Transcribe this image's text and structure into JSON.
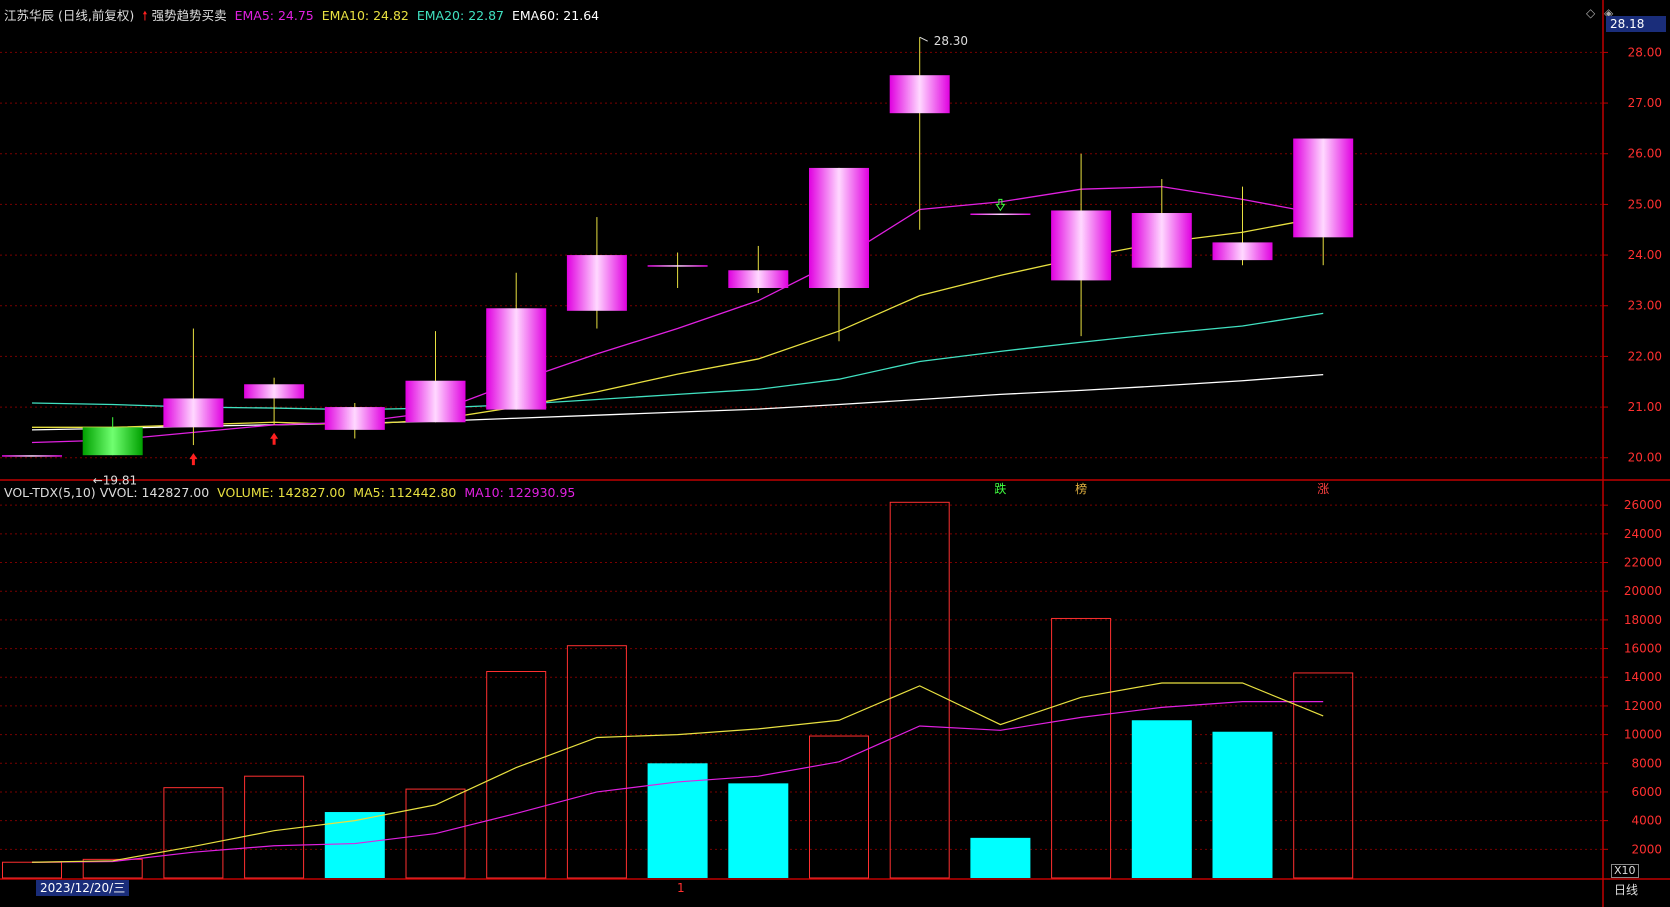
{
  "header": {
    "stock_title": "江苏华辰 (日线,前复权)",
    "indicator_name": "强势趋势买卖",
    "ema5": "EMA5: 24.75",
    "ema10": "EMA10: 24.82",
    "ema20": "EMA20: 22.87",
    "ema60": "EMA60: 21.64",
    "current_price": "28.18"
  },
  "volume_header": {
    "name": "VOL-TDX(5,10)",
    "vvol": "VVOL: 142827.00",
    "volume": "VOLUME: 142827.00",
    "ma5": "MA5: 112442.80",
    "ma10": "MA10: 122930.95"
  },
  "footer": {
    "date": "2023/12/20/三",
    "period": "日线",
    "unit": "X10",
    "marker": "1"
  },
  "colors": {
    "up": "#ff33ff",
    "down": "#00d000",
    "ema5": "#e020e0",
    "ema10": "#e8e040",
    "ema20": "#40e0c0",
    "ema60": "#ffffff",
    "vol_up": "#ff3030",
    "vol_down": "#00ffff",
    "grid": "#7a0000",
    "axis_text": "#ff3030"
  },
  "chart_data": [
    {
      "type": "candlestick",
      "ylim": [
        19.6,
        28.6
      ],
      "yticks": [
        "28.00",
        "27.00",
        "26.00",
        "25.00",
        "24.00",
        "23.00",
        "22.00",
        "21.00",
        "20.00"
      ],
      "high_label": "28.30",
      "low_label": "←19.81",
      "candles": [
        {
          "o": 20.05,
          "c": 20.05,
          "h": 20.05,
          "l": 20.05
        },
        {
          "o": 20.6,
          "c": 20.05,
          "h": 20.8,
          "l": 20.05
        },
        {
          "o": 20.6,
          "c": 21.17,
          "h": 22.55,
          "l": 20.25
        },
        {
          "o": 21.17,
          "c": 21.45,
          "h": 21.58,
          "l": 20.65
        },
        {
          "o": 20.55,
          "c": 21.0,
          "h": 21.08,
          "l": 20.38
        },
        {
          "o": 20.7,
          "c": 21.52,
          "h": 22.5,
          "l": 20.7
        },
        {
          "o": 20.95,
          "c": 22.95,
          "h": 23.65,
          "l": 20.95
        },
        {
          "o": 22.9,
          "c": 24.0,
          "h": 24.75,
          "l": 22.55
        },
        {
          "o": 23.8,
          "c": 23.8,
          "h": 24.05,
          "l": 23.35
        },
        {
          "o": 23.35,
          "c": 23.7,
          "h": 24.18,
          "l": 23.25
        },
        {
          "o": 23.35,
          "c": 25.72,
          "h": 25.72,
          "l": 22.3
        },
        {
          "o": 26.8,
          "c": 27.55,
          "h": 28.3,
          "l": 24.5
        },
        {
          "o": 24.82,
          "c": 24.82,
          "h": 24.82,
          "l": 24.82
        },
        {
          "o": 23.5,
          "c": 24.88,
          "h": 26.0,
          "l": 22.4
        },
        {
          "o": 23.75,
          "c": 24.83,
          "h": 25.5,
          "l": 23.75
        },
        {
          "o": 23.9,
          "c": 24.25,
          "h": 25.35,
          "l": 23.8
        },
        {
          "o": 24.35,
          "c": 26.3,
          "h": 26.3,
          "l": 23.8
        }
      ],
      "ema5": [
        20.3,
        20.35,
        20.5,
        20.65,
        20.7,
        20.9,
        21.5,
        22.05,
        22.55,
        23.1,
        23.9,
        24.9,
        25.05,
        25.3,
        25.35,
        25.1,
        24.8
      ],
      "ema10": [
        20.6,
        20.6,
        20.65,
        20.7,
        20.65,
        20.75,
        21.0,
        21.3,
        21.65,
        21.95,
        22.5,
        23.2,
        23.6,
        23.95,
        24.25,
        24.45,
        24.75
      ],
      "ema20": [
        21.08,
        21.05,
        21.0,
        20.98,
        20.95,
        20.98,
        21.05,
        21.15,
        21.25,
        21.35,
        21.55,
        21.9,
        22.1,
        22.28,
        22.45,
        22.6,
        22.85
      ],
      "ema60": [
        20.55,
        20.58,
        20.62,
        20.65,
        20.68,
        20.72,
        20.78,
        20.84,
        20.9,
        20.96,
        21.05,
        21.15,
        21.25,
        21.33,
        21.42,
        21.52,
        21.64
      ],
      "buy_arrows": [
        2,
        3
      ],
      "signal_labels": [
        {
          "index": 12,
          "text": "跌"
        },
        {
          "index": 13,
          "text": "榜"
        },
        {
          "index": 16,
          "text": "涨"
        }
      ]
    },
    {
      "type": "bar",
      "ylim": [
        0,
        26500
      ],
      "yticks": [
        "26000",
        "24000",
        "22000",
        "20000",
        "18000",
        "16000",
        "14000",
        "12000",
        "10000",
        "8000",
        "6000",
        "4000",
        "2000"
      ],
      "values": [
        1100,
        1300,
        6300,
        7100,
        4600,
        6200,
        14400,
        16200,
        8000,
        6600,
        9900,
        26200,
        2800,
        18100,
        11000,
        10200,
        14300
      ],
      "up": [
        true,
        true,
        true,
        true,
        false,
        true,
        true,
        true,
        false,
        false,
        true,
        true,
        false,
        true,
        false,
        false,
        true
      ],
      "ma5": [
        1100,
        1200,
        2200,
        3300,
        4000,
        5100,
        7700,
        9800,
        10000,
        10400,
        11000,
        13400,
        10700,
        12600,
        13600,
        13600,
        11300
      ],
      "ma10": [
        1100,
        1150,
        1800,
        2250,
        2400,
        3100,
        4500,
        6000,
        6700,
        7100,
        8100,
        10600,
        10300,
        11200,
        11900,
        12300,
        12300
      ]
    }
  ]
}
